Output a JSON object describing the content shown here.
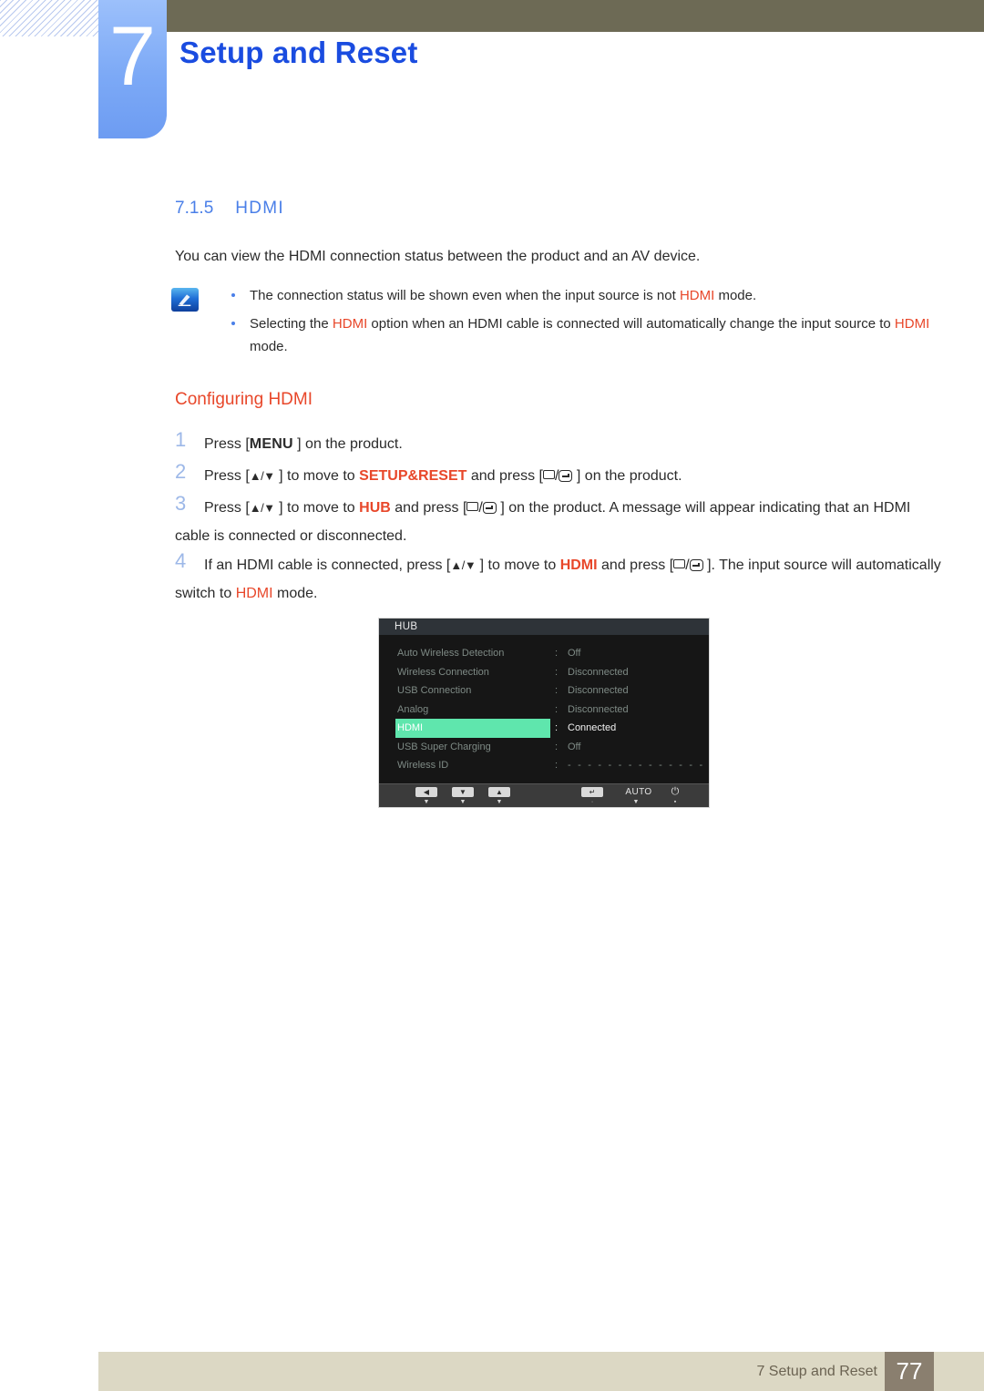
{
  "header": {
    "chapter_number": "7",
    "chapter_title": "Setup and Reset"
  },
  "section": {
    "number": "7.1.5",
    "title": "HDMI",
    "intro": "You can view the HDMI connection status between the product and an AV device."
  },
  "note": {
    "icon": "note-pen-icon",
    "bullets": [
      {
        "parts": [
          {
            "t": "The connection status will be shown even when the input source is not ",
            "s": "plain"
          },
          {
            "t": "HDMI",
            "s": "hi"
          },
          {
            "t": " mode.",
            "s": "plain"
          }
        ]
      },
      {
        "parts": [
          {
            "t": "Selecting the ",
            "s": "plain"
          },
          {
            "t": "HDMI",
            "s": "hi"
          },
          {
            "t": " option when an HDMI cable is connected will automatically change the input source to ",
            "s": "plain"
          },
          {
            "t": "HDMI",
            "s": "hi"
          },
          {
            "t": " mode.",
            "s": "plain"
          }
        ]
      }
    ]
  },
  "configuring": {
    "title": "Configuring HDMI",
    "steps": [
      {
        "number": "1",
        "parts": [
          {
            "t": "Press [",
            "s": "plain"
          },
          {
            "t": "MENU",
            "s": "key"
          },
          {
            "t": " ] on the product.",
            "s": "plain"
          }
        ]
      },
      {
        "number": "2",
        "parts": [
          {
            "t": "Press [",
            "s": "plain"
          },
          {
            "t": "▲/▼",
            "s": "gl"
          },
          {
            "t": " ] to move to ",
            "s": "plain"
          },
          {
            "t": "SETUP&RESET",
            "s": "hi-b"
          },
          {
            "t": " and press [",
            "s": "plain"
          },
          {
            "t": "BOX",
            "s": "box"
          },
          {
            "t": "/",
            "s": "plain"
          },
          {
            "t": "ENTER",
            "s": "ent"
          },
          {
            "t": " ] on the product.",
            "s": "plain"
          }
        ]
      },
      {
        "number": "3",
        "parts": [
          {
            "t": "Press [",
            "s": "plain"
          },
          {
            "t": "▲/▼",
            "s": "gl"
          },
          {
            "t": " ] to move to ",
            "s": "plain"
          },
          {
            "t": "HUB",
            "s": "hi-b"
          },
          {
            "t": " and press [",
            "s": "plain"
          },
          {
            "t": "BOX",
            "s": "box"
          },
          {
            "t": "/",
            "s": "plain"
          },
          {
            "t": "ENTER",
            "s": "ent"
          },
          {
            "t": " ] on the product. A message will appear indicating that an HDMI cable is connected or disconnected.",
            "s": "plain"
          }
        ]
      },
      {
        "number": "4",
        "parts": [
          {
            "t": "If an HDMI cable is connected, press [",
            "s": "plain"
          },
          {
            "t": "▲/▼",
            "s": "gl"
          },
          {
            "t": " ] to move to ",
            "s": "plain"
          },
          {
            "t": "HDMI",
            "s": "hi-b"
          },
          {
            "t": " and press [",
            "s": "plain"
          },
          {
            "t": "BOX",
            "s": "box"
          },
          {
            "t": "/",
            "s": "plain"
          },
          {
            "t": "ENTER",
            "s": "ent"
          },
          {
            "t": " ]. The input source will automatically switch to ",
            "s": "plain"
          },
          {
            "t": "HDMI",
            "s": "hi"
          },
          {
            "t": " mode.",
            "s": "plain"
          }
        ]
      }
    ]
  },
  "osd": {
    "title": "HUB",
    "separator": ":",
    "highlight_color": "#5fe6ad",
    "rows": [
      {
        "label": "Auto Wireless Detection",
        "value": "Off",
        "selected": false
      },
      {
        "label": "Wireless Connection",
        "value": "Disconnected",
        "selected": false
      },
      {
        "label": "USB Connection",
        "value": "Disconnected",
        "selected": false
      },
      {
        "label": "Analog",
        "value": "Disconnected",
        "selected": false
      },
      {
        "label": "HDMI",
        "value": "Connected",
        "selected": true
      },
      {
        "label": "USB Super Charging",
        "value": "Off",
        "selected": false
      },
      {
        "label": "Wireless ID",
        "value": "- - - - - - - - - - - - - - -",
        "selected": false
      }
    ],
    "buttons": [
      {
        "name": "left-arrow-button",
        "glyph": "◀",
        "sub": "▼"
      },
      {
        "name": "down-arrow-button",
        "glyph": "▼",
        "sub": "▼"
      },
      {
        "name": "up-arrow-button",
        "glyph": "▲",
        "sub": "▼"
      },
      {
        "name": "enter-button",
        "glyph": "↵",
        "sub": "·"
      },
      {
        "name": "auto-button",
        "glyph": "AUTO",
        "sub": "▼"
      },
      {
        "name": "power-button",
        "glyph": "⏻",
        "sub": "▪"
      }
    ]
  },
  "footer": {
    "text": "7 Setup and Reset",
    "page": "77"
  }
}
